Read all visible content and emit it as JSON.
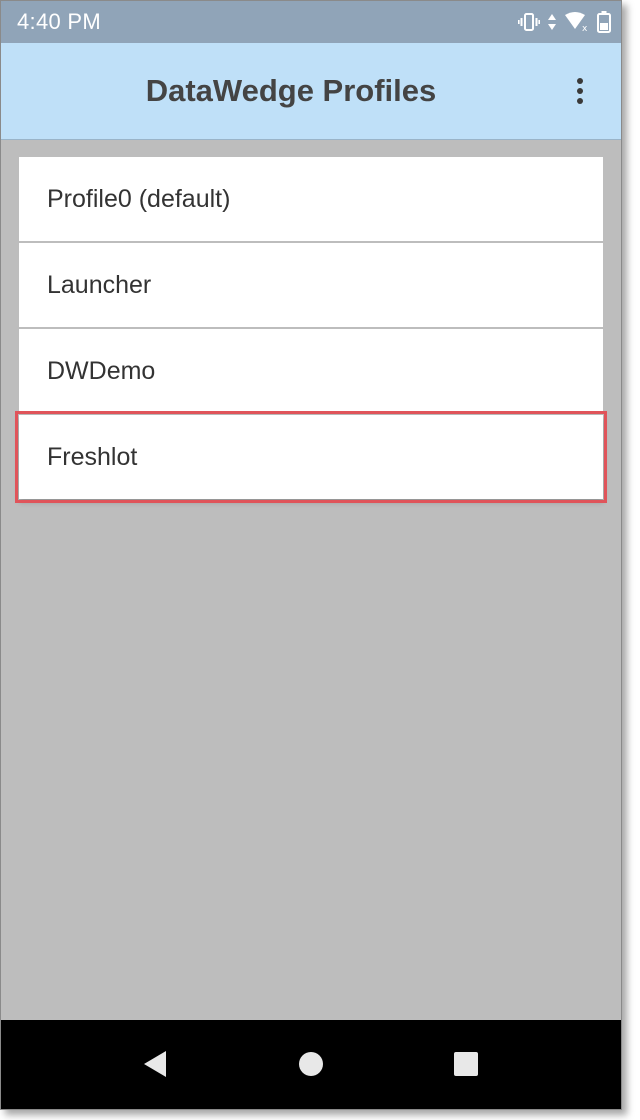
{
  "status_bar": {
    "time": "4:40 PM",
    "icons": [
      "vibrate-icon",
      "data-arrows-icon",
      "wifi-icon",
      "battery-icon"
    ]
  },
  "app_bar": {
    "title": "DataWedge Profiles",
    "overflow_icon": "more-vert-icon"
  },
  "profiles": [
    {
      "label": "Profile0 (default)",
      "highlighted": false
    },
    {
      "label": "Launcher",
      "highlighted": false
    },
    {
      "label": "DWDemo",
      "highlighted": false
    },
    {
      "label": "Freshlot",
      "highlighted": true
    }
  ],
  "nav_bar": {
    "buttons": [
      "back-icon",
      "home-icon",
      "recents-icon"
    ]
  },
  "colors": {
    "status_bar": "#90a4b8",
    "app_bar": "#bfe0f8",
    "background": "#bdbdbd",
    "highlight": "#e0545a"
  }
}
